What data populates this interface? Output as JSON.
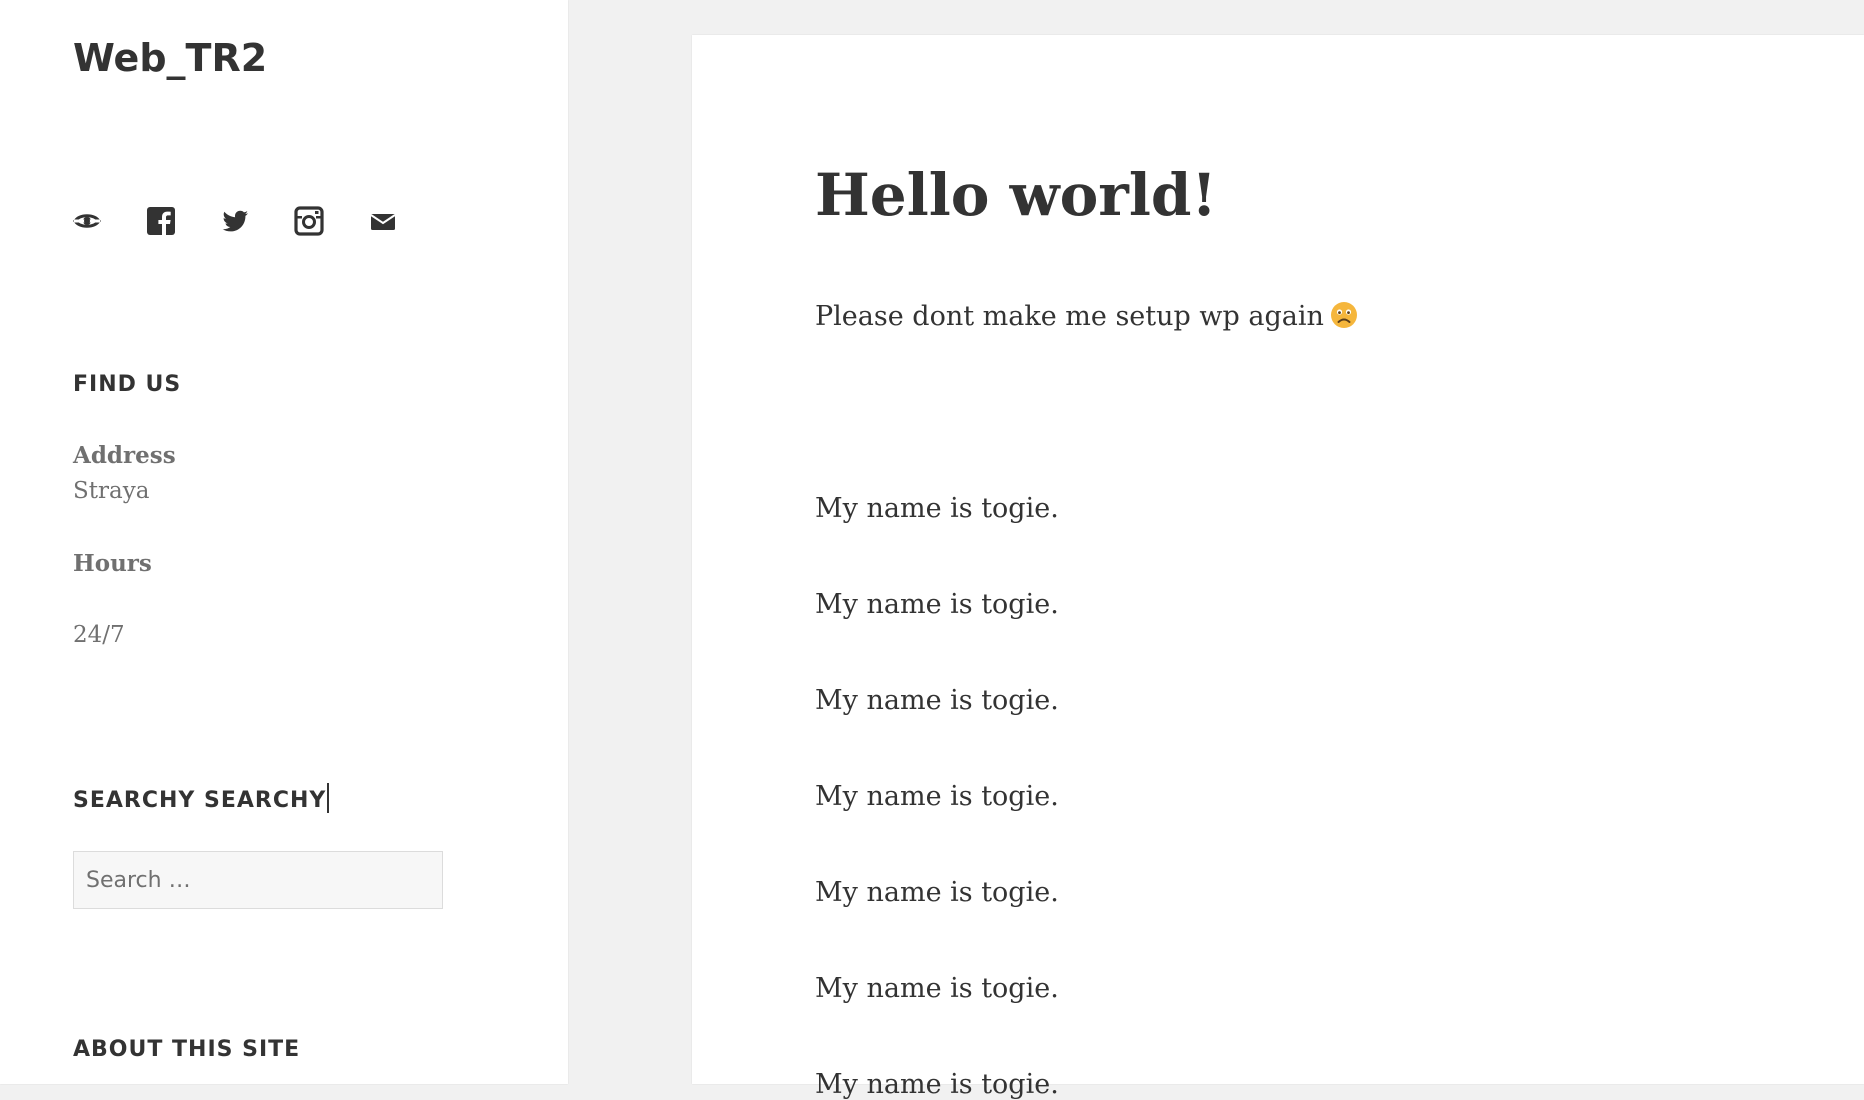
{
  "site": {
    "title": "Web_TR2"
  },
  "social_icons": [
    {
      "name": "website-icon"
    },
    {
      "name": "facebook-icon"
    },
    {
      "name": "twitter-icon"
    },
    {
      "name": "instagram-icon"
    },
    {
      "name": "email-icon"
    }
  ],
  "find_us": {
    "title": "FIND US",
    "address_label": "Address",
    "address_value": "Straya",
    "hours_label": "Hours",
    "hours_value": "24/7"
  },
  "search_widget": {
    "title": "SEARCHY SEARCHY",
    "placeholder": "Search …"
  },
  "about": {
    "title": "ABOUT THIS SITE"
  },
  "post": {
    "title": "Hello world!",
    "intro": "Please dont make me setup wp again",
    "intro_emoji": "sad-face-emoji",
    "paragraphs": [
      "My name is togie.",
      "My name is togie.",
      "My name is togie.",
      "My name is togie.",
      "My name is togie.",
      "My name is togie.",
      "My name is togie."
    ]
  },
  "colors": {
    "background": "#f1f1f1",
    "panel": "#ffffff",
    "text": "#333333",
    "muted": "#707070",
    "emoji": "#f5b63c"
  }
}
